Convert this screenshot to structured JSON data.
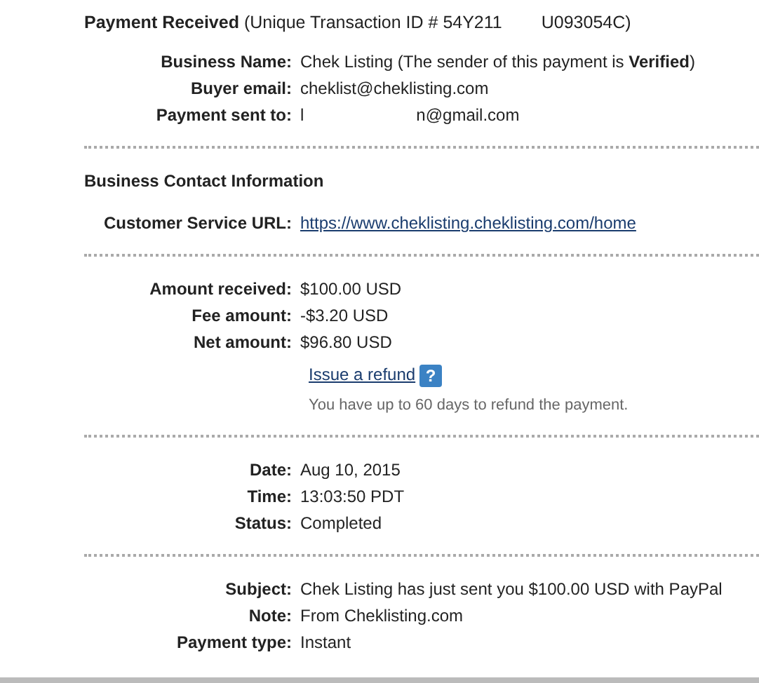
{
  "header": {
    "title": "**Payment Received** (Unique Transaction ID # 54Y211",
    "title_tail": "U093054C)"
  },
  "sections": [
    {
      "rows": [
        {
          "kind": "rich",
          "label": "Business Name:",
          "value": "Chek Listing (The sender of this payment is **Verified**)"
        },
        {
          "kind": "text",
          "label": "Buyer email:",
          "value": "cheklist@cheklisting.com"
        },
        {
          "kind": "split",
          "label": "Payment sent to:",
          "value": "l",
          "value_tail": "n@gmail.com"
        }
      ]
    },
    {
      "heading": "Business Contact Information",
      "rows": [
        {
          "kind": "link",
          "label": "Customer Service URL:",
          "value": "https://www.cheklisting.cheklisting.com/home"
        }
      ]
    },
    {
      "rows": [
        {
          "kind": "text",
          "label": "Amount received:",
          "value": "$100.00 USD"
        },
        {
          "kind": "text",
          "label": "Fee amount:",
          "value": "-$3.20 USD"
        },
        {
          "kind": "text",
          "label": "Net amount:",
          "value": "$96.80 USD"
        },
        {
          "kind": "action",
          "link": "Issue a refund",
          "help": "?",
          "note": "You have up to 60 days to refund the payment."
        }
      ]
    },
    {
      "rows": [
        {
          "kind": "text",
          "label": "Date:",
          "value": "Aug 10, 2015"
        },
        {
          "kind": "text",
          "label": "Time:",
          "value": "13:03:50 PDT"
        },
        {
          "kind": "text",
          "label": "Status:",
          "value": "Completed"
        }
      ]
    },
    {
      "rows": [
        {
          "kind": "text",
          "label": "Subject:",
          "value": "Chek Listing has just sent you $100.00 USD with PayPal"
        },
        {
          "kind": "text",
          "label": "Note:",
          "value": "From Cheklisting.com"
        },
        {
          "kind": "text",
          "label": "Payment type:",
          "value": "Instant"
        }
      ]
    }
  ]
}
